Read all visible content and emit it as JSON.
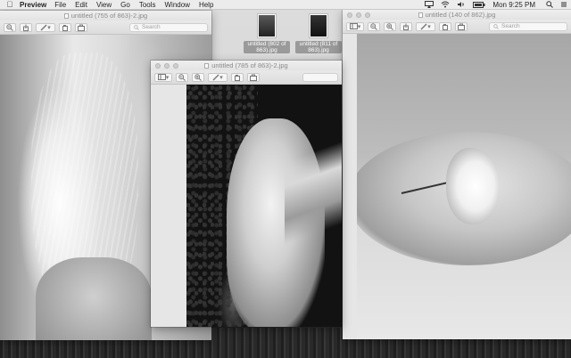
{
  "menubar": {
    "app_name": "Preview",
    "menus": [
      "File",
      "Edit",
      "View",
      "Go",
      "Tools",
      "Window",
      "Help"
    ],
    "clock": "Mon 9:25 PM"
  },
  "desktop_icons": [
    {
      "label": "untitled (802 of 863).jpg"
    },
    {
      "label": "untitled (811 of 863).jpg"
    }
  ],
  "windows": [
    {
      "title": "untitled (755 of 863)-2.jpg",
      "search_placeholder": "Search"
    },
    {
      "title": "untitled (785 of 863)-2.jpg",
      "search_placeholder": ""
    },
    {
      "title": "untitled (140 of 862).jpg",
      "search_placeholder": "Search"
    }
  ],
  "colors": {
    "menubar_bg": "#ececec",
    "window_chrome": "#e3e3e3"
  }
}
